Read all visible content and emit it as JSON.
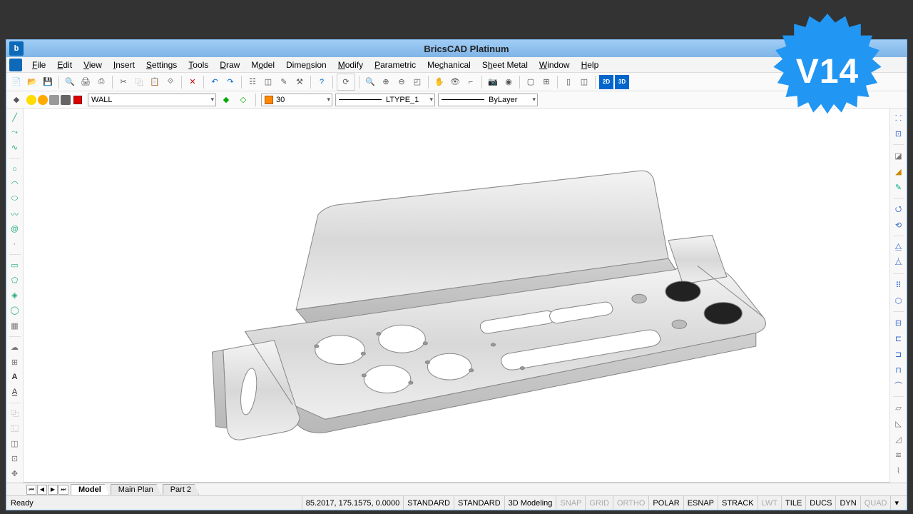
{
  "badge": {
    "text": "V14"
  },
  "title": "BricsCAD Platinum",
  "menus": [
    "File",
    "Edit",
    "View",
    "Insert",
    "Settings",
    "Tools",
    "Draw",
    "Model",
    "Dimension",
    "Modify",
    "Parametric",
    "Mechanical",
    "Sheet Metal",
    "Window",
    "Help"
  ],
  "layer": {
    "current": "WALL",
    "color_index": "30",
    "linetype": "LTYPE_1",
    "lineweight": "ByLayer"
  },
  "tabs": {
    "active": "Model",
    "others": [
      "Main Plan",
      "Part 2"
    ]
  },
  "status": {
    "ready": "Ready",
    "coords": "85.2017, 175.1575, 0.0000",
    "std1": "STANDARD",
    "std2": "STANDARD",
    "workspace": "3D Modeling",
    "toggles": [
      {
        "label": "SNAP",
        "on": false
      },
      {
        "label": "GRID",
        "on": false
      },
      {
        "label": "ORTHO",
        "on": false
      },
      {
        "label": "POLAR",
        "on": true
      },
      {
        "label": "ESNAP",
        "on": true
      },
      {
        "label": "STRACK",
        "on": true
      },
      {
        "label": "LWT",
        "on": false
      },
      {
        "label": "TILE",
        "on": true
      },
      {
        "label": "DUCS",
        "on": true
      },
      {
        "label": "DYN",
        "on": true
      },
      {
        "label": "QUAD",
        "on": false
      }
    ]
  }
}
